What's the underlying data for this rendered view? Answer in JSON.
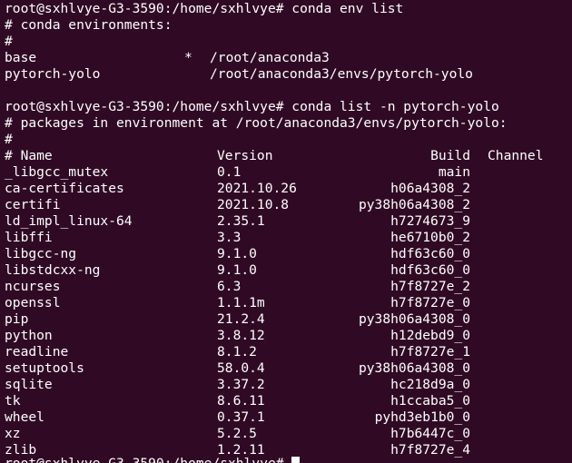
{
  "terminal": {
    "bg_color": "#300a24",
    "fg_color": "#ffffff",
    "command1": "root@sxhlvye-G3-3590:/home/sxhlvye# conda env list",
    "env_header": "# conda environments:",
    "hash": "#",
    "environments": [
      {
        "name": "base",
        "marker": "*",
        "path": "/root/anaconda3"
      },
      {
        "name": "pytorch-yolo",
        "marker": "",
        "path": "/root/anaconda3/envs/pytorch-yolo"
      }
    ],
    "command2": "root@sxhlvye-G3-3590:/home/sxhlvye# conda list -n pytorch-yolo",
    "pkg_header": "# packages in environment at /root/anaconda3/envs/pytorch-yolo:",
    "columns": {
      "name": "# Name",
      "version": "Version",
      "build": "Build",
      "channel": "Channel"
    },
    "packages": [
      {
        "name": "_libgcc_mutex",
        "version": "0.1",
        "build": "main"
      },
      {
        "name": "ca-certificates",
        "version": "2021.10.26",
        "build": "h06a4308_2"
      },
      {
        "name": "certifi",
        "version": "2021.10.8",
        "build": "py38h06a4308_2"
      },
      {
        "name": "ld_impl_linux-64",
        "version": "2.35.1",
        "build": "h7274673_9"
      },
      {
        "name": "libffi",
        "version": "3.3",
        "build": "he6710b0_2"
      },
      {
        "name": "libgcc-ng",
        "version": "9.1.0",
        "build": "hdf63c60_0"
      },
      {
        "name": "libstdcxx-ng",
        "version": "9.1.0",
        "build": "hdf63c60_0"
      },
      {
        "name": "ncurses",
        "version": "6.3",
        "build": "h7f8727e_2"
      },
      {
        "name": "openssl",
        "version": "1.1.1m",
        "build": "h7f8727e_0"
      },
      {
        "name": "pip",
        "version": "21.2.4",
        "build": "py38h06a4308_0"
      },
      {
        "name": "python",
        "version": "3.8.12",
        "build": "h12debd9_0"
      },
      {
        "name": "readline",
        "version": "8.1.2",
        "build": "h7f8727e_1"
      },
      {
        "name": "setuptools",
        "version": "58.0.4",
        "build": "py38h06a4308_0"
      },
      {
        "name": "sqlite",
        "version": "3.37.2",
        "build": "hc218d9a_0"
      },
      {
        "name": "tk",
        "version": "8.6.11",
        "build": "h1ccaba5_0"
      },
      {
        "name": "wheel",
        "version": "0.37.1",
        "build": "pyhd3eb1b0_0"
      },
      {
        "name": "xz",
        "version": "5.2.5",
        "build": "h7b6447c_0"
      },
      {
        "name": "zlib",
        "version": "1.2.11",
        "build": "h7f8727e_4"
      }
    ],
    "prompt_partial": "root@sxhlvye-G3-3590:/home/sxhlvye# "
  }
}
